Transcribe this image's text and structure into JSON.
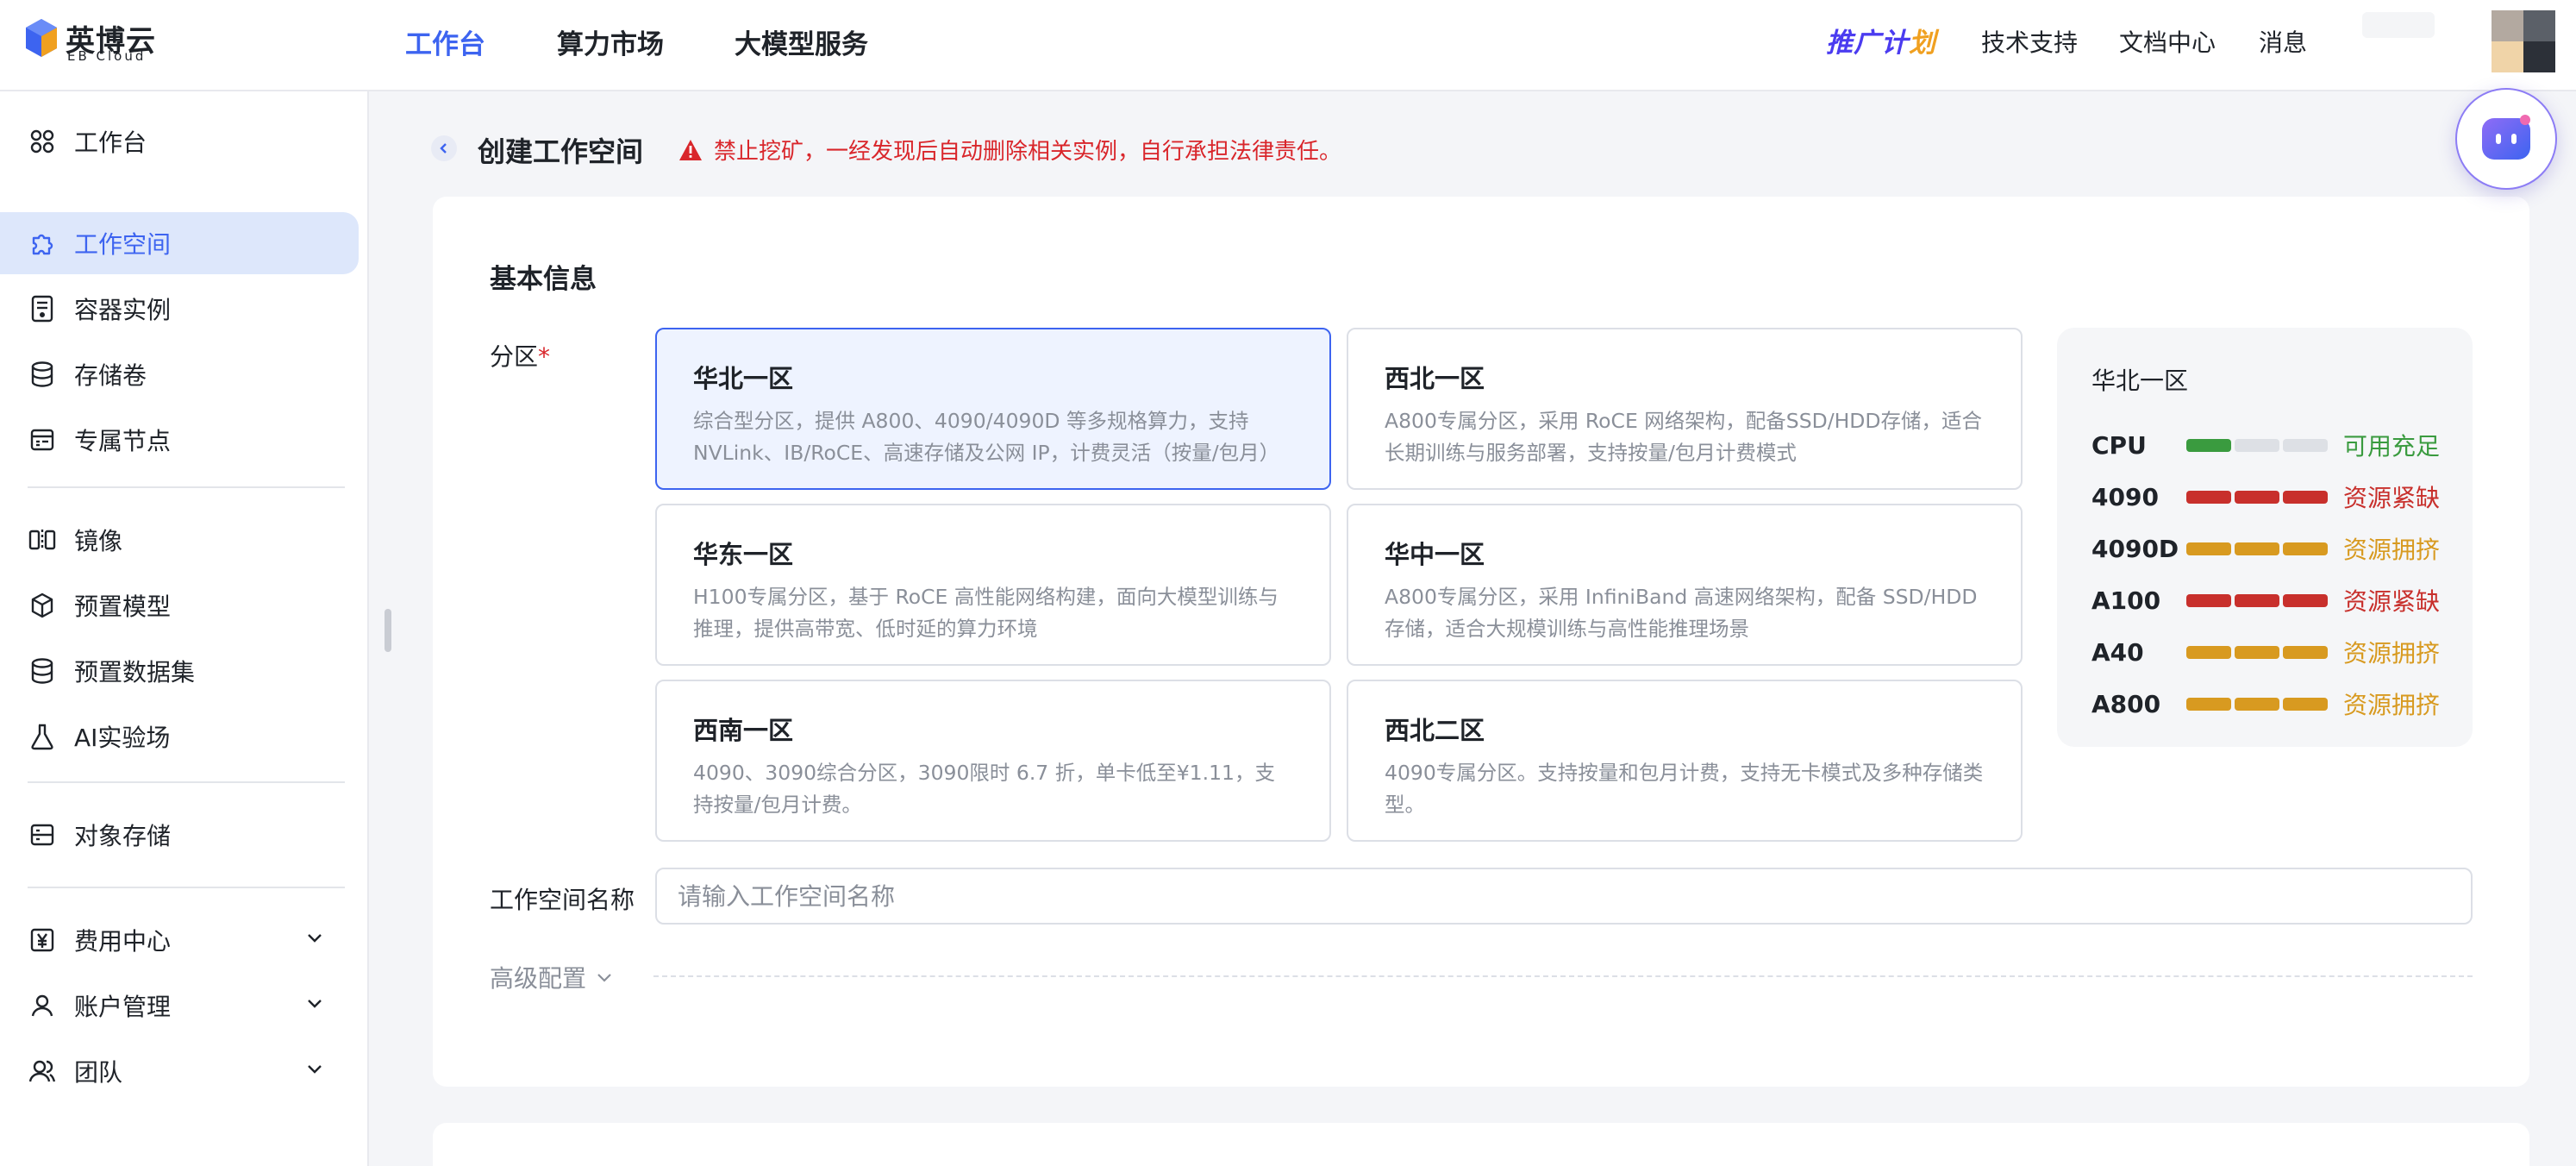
{
  "header": {
    "logo_cn": "英博云",
    "logo_en": "EB Cloud",
    "nav": [
      "工作台",
      "算力市场",
      "大模型服务"
    ],
    "promo_main": "推广计",
    "promo_accent": "划",
    "right_nav": [
      "技术支持",
      "文档中心",
      "消息"
    ]
  },
  "sidebar": {
    "items": [
      {
        "label": "工作台",
        "icon": "grid-icon"
      },
      {
        "label": "工作空间",
        "icon": "puzzle-icon"
      },
      {
        "label": "容器实例",
        "icon": "container-icon"
      },
      {
        "label": "存储卷",
        "icon": "database-icon"
      },
      {
        "label": "专属节点",
        "icon": "node-icon"
      },
      {
        "label": "镜像",
        "icon": "mirror-icon"
      },
      {
        "label": "预置模型",
        "icon": "cube-icon"
      },
      {
        "label": "预置数据集",
        "icon": "dataset-icon"
      },
      {
        "label": "AI实验场",
        "icon": "flask-icon"
      },
      {
        "label": "对象存储",
        "icon": "bucket-icon"
      },
      {
        "label": "费用中心",
        "icon": "yen-icon"
      },
      {
        "label": "账户管理",
        "icon": "user-icon"
      },
      {
        "label": "团队",
        "icon": "team-icon"
      }
    ],
    "active": "工作空间"
  },
  "page": {
    "title": "创建工作空间",
    "warning": "禁止挖矿，一经发现后自动删除相关实例，自行承担法律责任。"
  },
  "form": {
    "section_title": "基本信息",
    "region_label": "分区",
    "required_mark": "*",
    "regions": [
      {
        "name": "华北一区",
        "desc": "综合型分区，提供 A800、4090/4090D 等多规格算力，支持 NVLink、IB/RoCE、高速存储及公网 IP，计费灵活（按量/包月）"
      },
      {
        "name": "西北一区",
        "desc": "A800专属分区，采用 RoCE 网络架构，配备SSD/HDD存储，适合长期训练与服务部署，支持按量/包月计费模式"
      },
      {
        "name": "华东一区",
        "desc": "H100专属分区，基于 RoCE 高性能网络构建，面向大模型训练与推理，提供高带宽、低时延的算力环境"
      },
      {
        "name": "华中一区",
        "desc": "A800专属分区，采用 InfiniBand 高速网络架构，配备 SSD/HDD 存储，适合大规模训练与高性能推理场景"
      },
      {
        "name": "西南一区",
        "desc": "4090、3090综合分区，3090限时 6.7 折，单卡低至¥1.11，支持按量/包月计费。"
      },
      {
        "name": "西北二区",
        "desc": "4090专属分区。支持按量和包月计费，支持无卡模式及多种存储类型。"
      }
    ],
    "selected_region": "华北一区",
    "name_label": "工作空间名称",
    "name_placeholder": "请输入工作空间名称",
    "advanced_label": "高级配置"
  },
  "resource_status": {
    "title": "华北一区",
    "rows": [
      {
        "name": "CPU",
        "status": "可用充足",
        "level": 1,
        "color": "#3a9b3f"
      },
      {
        "name": "4090",
        "status": "资源紧缺",
        "level": 3,
        "color": "#c8302c"
      },
      {
        "name": "4090D",
        "status": "资源拥挤",
        "level": 3,
        "color": "#d89a20"
      },
      {
        "name": "A100",
        "status": "资源紧缺",
        "level": 3,
        "color": "#c8302c"
      },
      {
        "name": "A40",
        "status": "资源拥挤",
        "level": 3,
        "color": "#d89a20"
      },
      {
        "name": "A800",
        "status": "资源拥挤",
        "level": 3,
        "color": "#d89a20"
      }
    ]
  },
  "colors": {
    "accent": "#3d64f0",
    "danger": "#d9262b"
  }
}
